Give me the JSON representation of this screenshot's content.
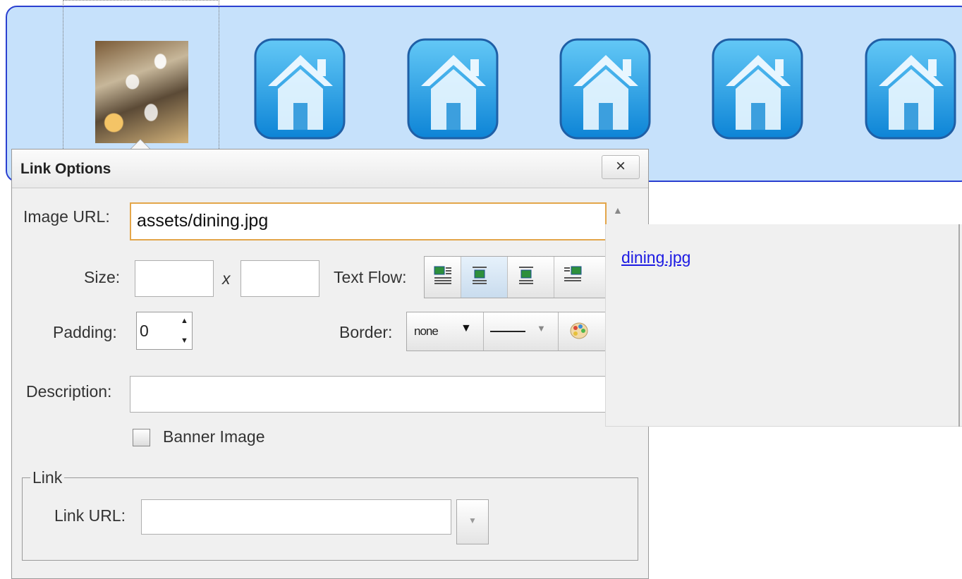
{
  "image_bar": {
    "thumbnails": [
      {
        "kind": "photo",
        "icon": "photo-thumbnail",
        "selected": true
      },
      {
        "kind": "icon",
        "icon": "home-icon"
      },
      {
        "kind": "icon",
        "icon": "home-icon"
      },
      {
        "kind": "icon",
        "icon": "home-icon"
      },
      {
        "kind": "icon",
        "icon": "home-icon"
      },
      {
        "kind": "icon",
        "icon": "home-icon"
      }
    ]
  },
  "dialog": {
    "title": "Link Options",
    "close_label": "×",
    "image_url": {
      "label": "Image URL:",
      "value": "assets/dining.jpg"
    },
    "size": {
      "label": "Size:",
      "separator": "x",
      "width": "",
      "height": ""
    },
    "text_flow": {
      "label": "Text Flow:",
      "options": [
        "wrap-left",
        "inline",
        "center",
        "wrap-right"
      ],
      "selected": "inline"
    },
    "padding": {
      "label": "Padding:",
      "value": "0"
    },
    "border": {
      "label": "Border:",
      "style_value": "none"
    },
    "description": {
      "label": "Description:",
      "value": ""
    },
    "banner": {
      "label": "Banner Image",
      "checked": false
    },
    "link": {
      "legend": "Link",
      "url_label": "Link URL:",
      "url_value": ""
    }
  },
  "autocomplete": {
    "items": [
      "dining.jpg"
    ]
  },
  "colors": {
    "bar_bg": "#c6e1fb",
    "bar_border": "#2a3fd0",
    "focus_border": "#e3a64a",
    "link": "#1c1ae3"
  }
}
